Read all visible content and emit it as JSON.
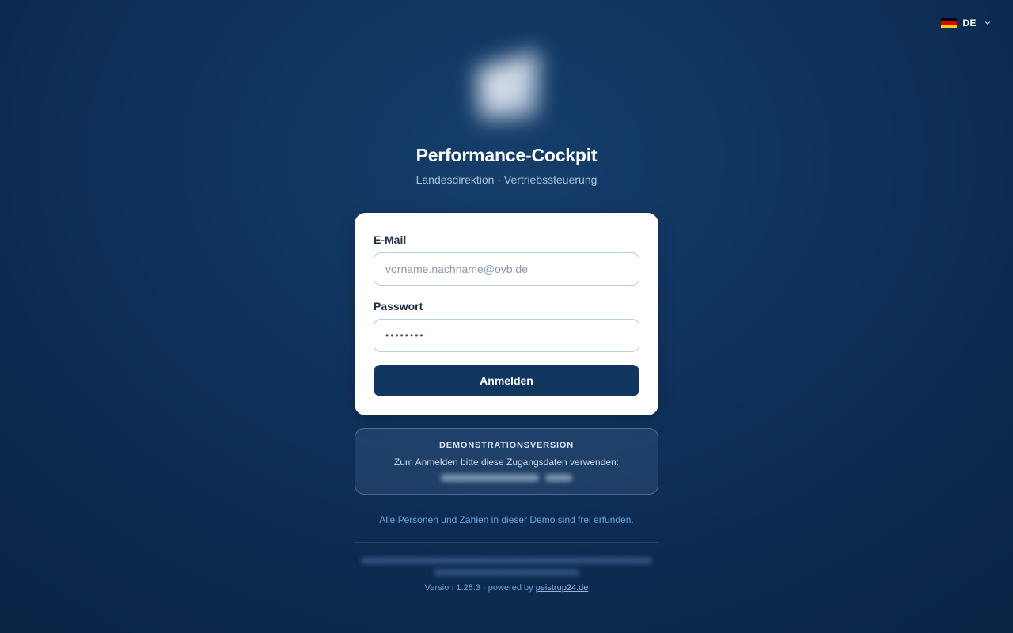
{
  "language": {
    "code": "DE",
    "flag_colors": [
      "#000000",
      "#dd0000",
      "#ffce00"
    ]
  },
  "header": {
    "title": "Performance-Cockpit",
    "subtitle": "Landesdirektion · Vertriebssteuerung"
  },
  "login_form": {
    "email_label": "E-Mail",
    "email_placeholder": "vorname.nachname@ovb.de",
    "password_label": "Passwort",
    "password_value": "••••••••",
    "submit_label": "Anmelden"
  },
  "demo_notice": {
    "title": "DEMONSTRATIONSVERSION",
    "text": "Zum Anmelden bitte diese Zugangsdaten verwenden:"
  },
  "disclaimer": "Alle Personen und Zahlen in dieser Demo sind frei erfunden.",
  "footer": {
    "version_text": "Version 1.28.3 · powered by",
    "powered_by_link": "peistrup24.de"
  },
  "colors": {
    "background": "#0f325a",
    "primary_button": "#11365f",
    "card": "#ffffff",
    "accent_text": "#6ea3d6"
  }
}
